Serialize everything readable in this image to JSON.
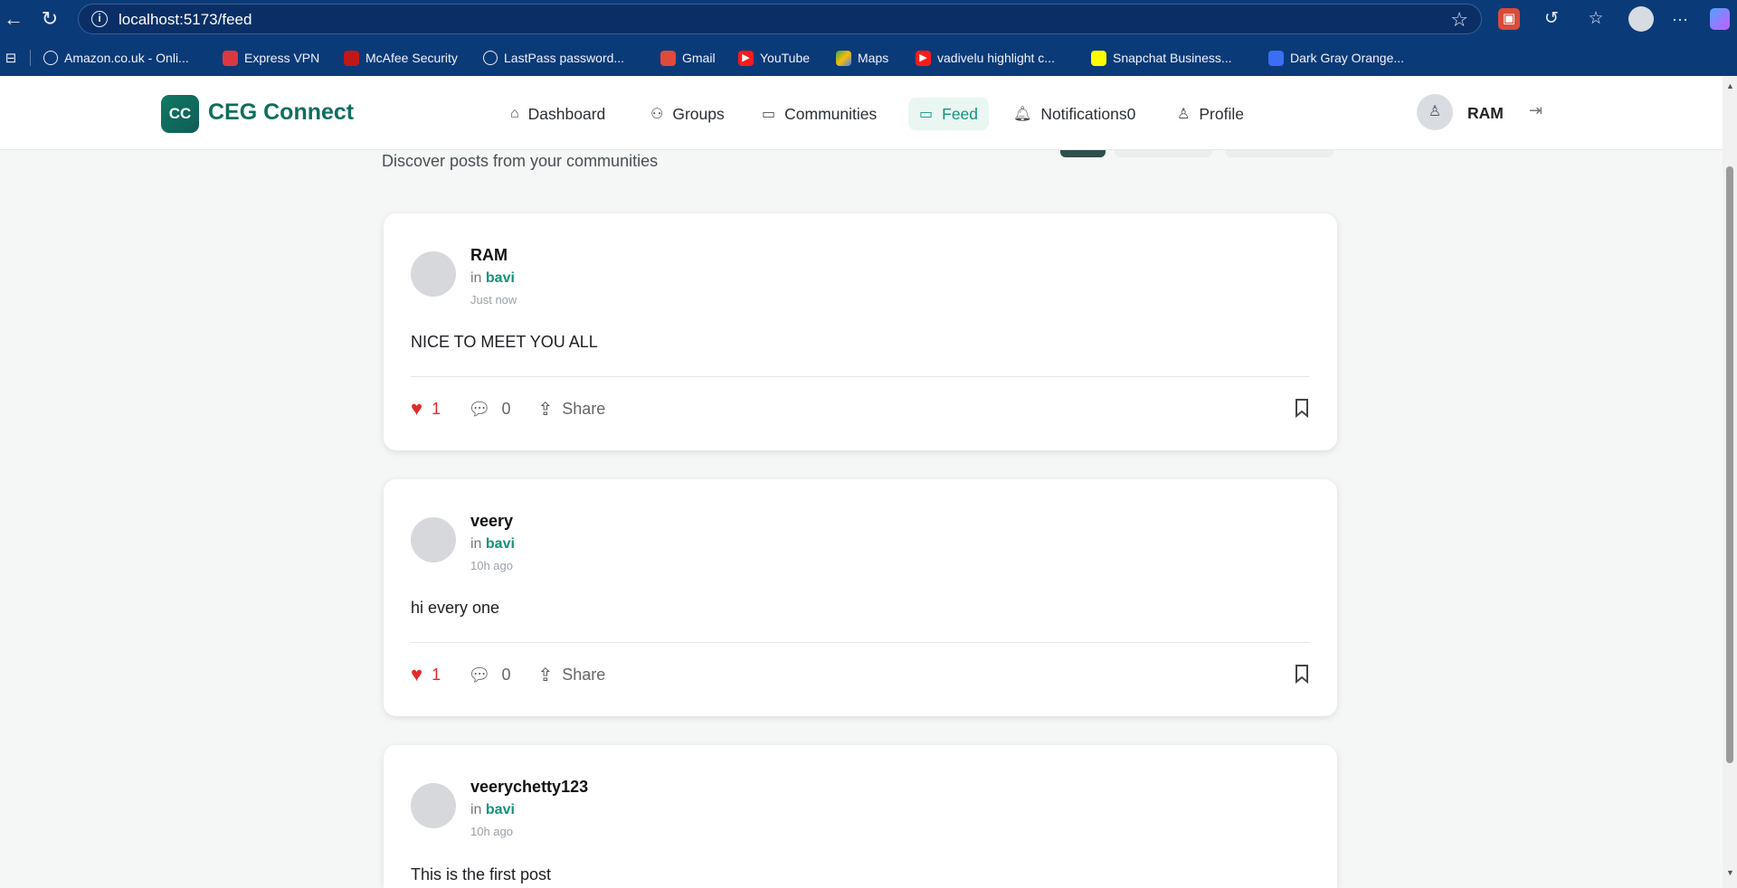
{
  "browser": {
    "url": "localhost:5173/feed",
    "bookmarks": [
      {
        "label": "Amazon.co.uk - Onli...",
        "icon": "globe-icon"
      },
      {
        "label": "Express VPN",
        "icon": "expressvpn-icon"
      },
      {
        "label": "McAfee Security",
        "icon": "mcafee-icon"
      },
      {
        "label": "LastPass password...",
        "icon": "globe-icon"
      },
      {
        "label": "Gmail",
        "icon": "gmail-icon"
      },
      {
        "label": "YouTube",
        "icon": "youtube-icon"
      },
      {
        "label": "Maps",
        "icon": "maps-icon"
      },
      {
        "label": "vadivelu highlight c...",
        "icon": "youtube-icon"
      },
      {
        "label": "Snapchat Business...",
        "icon": "snapchat-icon"
      },
      {
        "label": "Dark Gray Orange...",
        "icon": "doc-icon"
      }
    ]
  },
  "app": {
    "logo_initials": "CC",
    "name": "CEG Connect",
    "nav": [
      {
        "label": "Dashboard",
        "icon": "home-icon"
      },
      {
        "label": "Groups",
        "icon": "users-icon"
      },
      {
        "label": "Communities",
        "icon": "message-square-icon"
      },
      {
        "label": "Feed",
        "icon": "message-square-icon",
        "active": true
      },
      {
        "label": "Notifications0",
        "icon": "bell-icon"
      },
      {
        "label": "Profile",
        "icon": "user-icon"
      }
    ],
    "user": {
      "name": "RAM"
    }
  },
  "feed": {
    "subtitle": "Discover posts from your communities",
    "share_label": "Share",
    "posts": [
      {
        "author": "RAM",
        "in_label": "in",
        "community": "bavi",
        "time": "Just now",
        "content": "NICE TO MEET YOU ALL",
        "likes": "1",
        "comments": "0"
      },
      {
        "author": "veery",
        "in_label": "in",
        "community": "bavi",
        "time": "10h ago",
        "content": "hi every one",
        "likes": "1",
        "comments": "0"
      },
      {
        "author": "veerychetty123",
        "in_label": "in",
        "community": "bavi",
        "time": "10h ago",
        "content": "This is the first post"
      }
    ]
  },
  "colors": {
    "browser_chrome": "#0b3a78",
    "brand": "#0f6e5e",
    "accent": "#11927a",
    "like": "#e12b2b"
  }
}
